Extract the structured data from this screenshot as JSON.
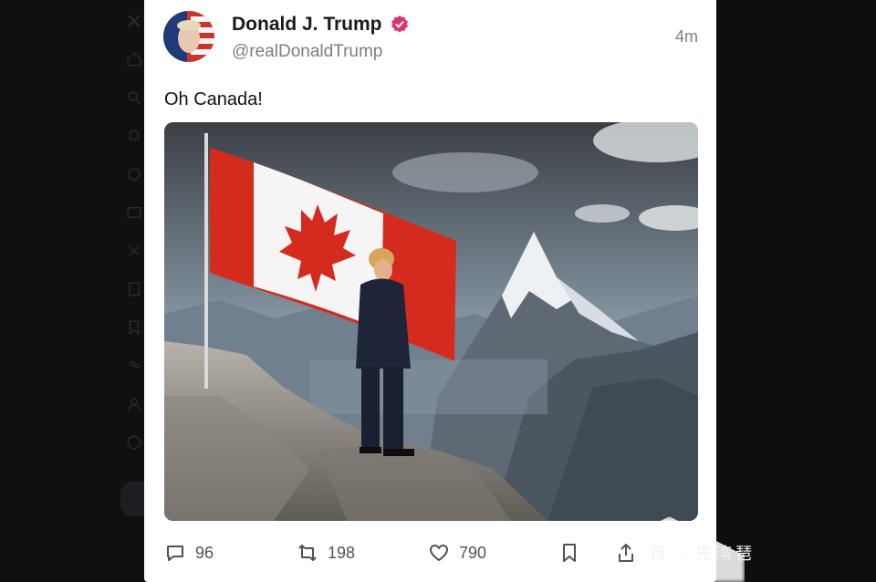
{
  "tweet": {
    "author_name": "Donald J. Trump",
    "handle": "@realDonaldTrump",
    "time": "4m",
    "text": "Oh Canada!",
    "media": "ai-image-man-with-canadian-flag-on-mountain"
  },
  "actions": {
    "replies": "96",
    "reposts": "198",
    "likes": "790"
  },
  "icons": {
    "verified": "verified-badge-icon",
    "reply": "comment-icon",
    "repost": "repost-icon",
    "like": "heart-icon",
    "bookmark": "bookmark-icon",
    "share": "share-icon"
  },
  "colors": {
    "verified_badge": "#e0326e",
    "flag_red": "#d52b1e",
    "text_muted": "#7a7f85"
  },
  "watermark": "目 · 先湾琶"
}
